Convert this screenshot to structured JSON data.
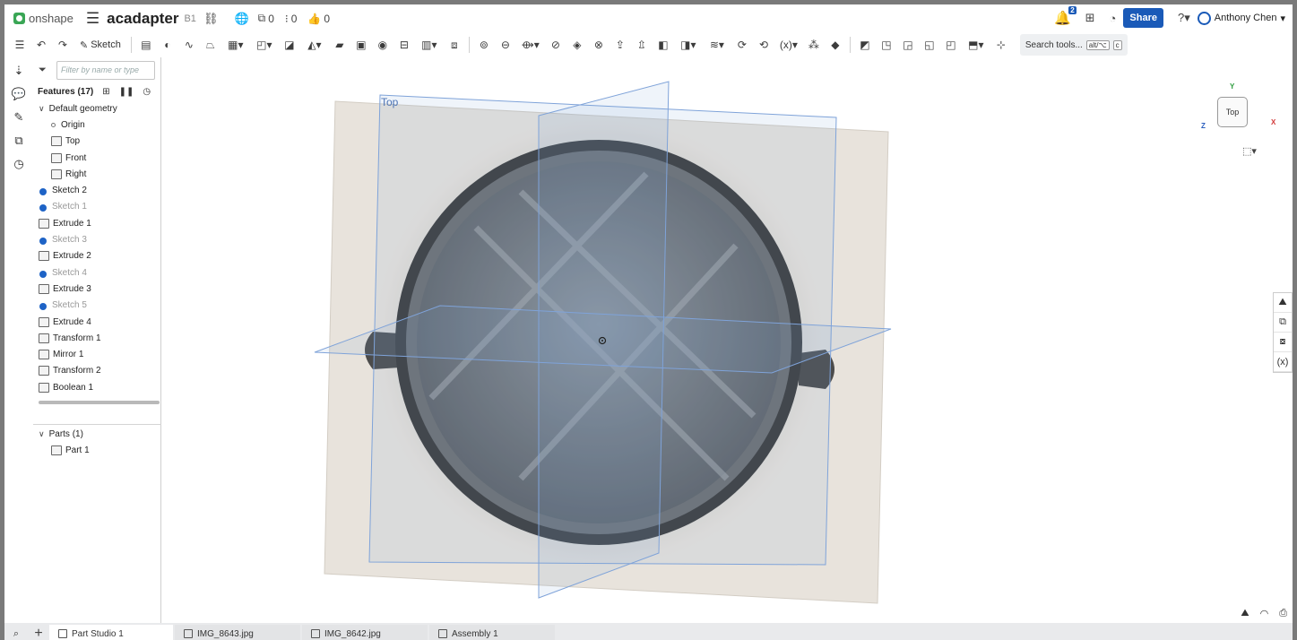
{
  "app": {
    "logo_text": "onshape",
    "doc_name": "acadapter",
    "version": "B1"
  },
  "counts": {
    "versions": "0",
    "branches": "0",
    "likes": "0"
  },
  "header": {
    "notifications": "2",
    "share_label": "Share",
    "user_name": "Anthony Chen"
  },
  "toolbar": {
    "sketch_label": "Sketch",
    "search_label": "Search tools...",
    "search_kbd1": "alt/⌥",
    "search_kbd2": "c"
  },
  "panel": {
    "filter_placeholder": "Filter by name or type",
    "features_title": "Features (17)",
    "default_geometry": "Default geometry",
    "geometry": [
      "Origin",
      "Top",
      "Front",
      "Right"
    ],
    "features": [
      {
        "label": "Sketch 2",
        "dim": false
      },
      {
        "label": "Sketch 1",
        "dim": true
      },
      {
        "label": "Extrude 1",
        "dim": false
      },
      {
        "label": "Sketch 3",
        "dim": true
      },
      {
        "label": "Extrude 2",
        "dim": false
      },
      {
        "label": "Sketch 4",
        "dim": true
      },
      {
        "label": "Extrude 3",
        "dim": false
      },
      {
        "label": "Sketch 5",
        "dim": true
      },
      {
        "label": "Extrude 4",
        "dim": false
      },
      {
        "label": "Transform 1",
        "dim": false
      },
      {
        "label": "Mirror 1",
        "dim": false
      },
      {
        "label": "Transform 2",
        "dim": false
      },
      {
        "label": "Boolean 1",
        "dim": false
      }
    ],
    "parts_title": "Parts (1)",
    "parts": [
      "Part 1"
    ]
  },
  "viewport": {
    "plane_label": "Top",
    "cube_face": "Top",
    "axis_y": "Y",
    "axis_x": "X",
    "axis_z": "Z"
  },
  "tabs": [
    {
      "label": "Part Studio 1",
      "active": true
    },
    {
      "label": "IMG_8643.jpg",
      "active": false
    },
    {
      "label": "IMG_8642.jpg",
      "active": false
    },
    {
      "label": "Assembly 1",
      "active": false
    }
  ],
  "colors": {
    "accent": "#1a5ab8",
    "plane": "#7fa3d9",
    "ring": "#3b3b3b"
  }
}
